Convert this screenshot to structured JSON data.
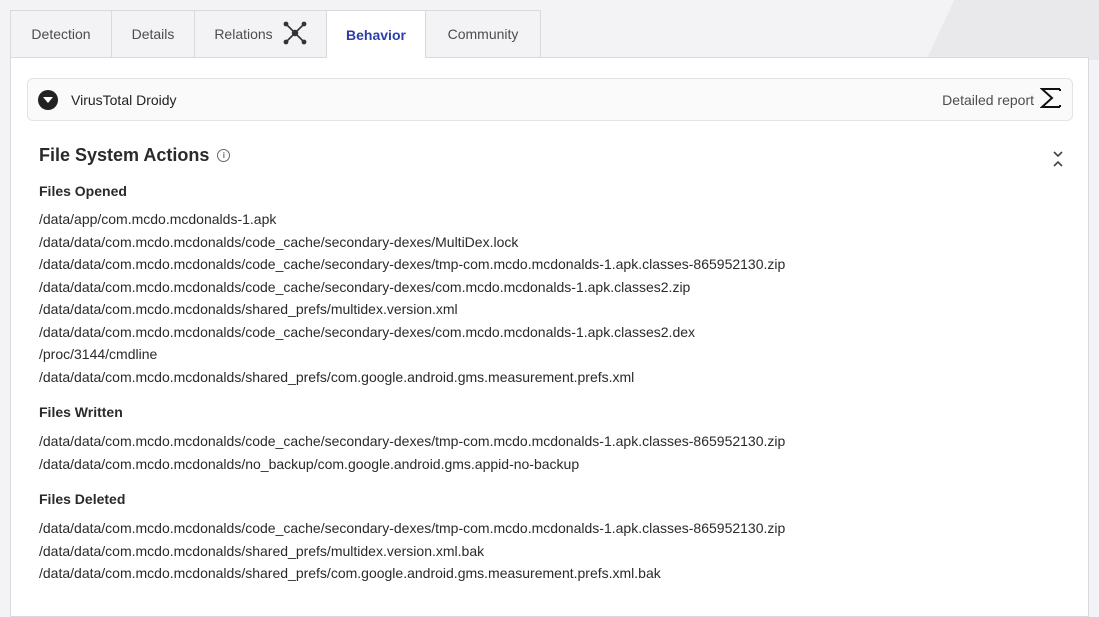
{
  "tabs": [
    {
      "label": "Detection"
    },
    {
      "label": "Details"
    },
    {
      "label": "Relations",
      "icon": "graph-nodes-icon"
    },
    {
      "label": "Behavior",
      "active": true
    },
    {
      "label": "Community"
    }
  ],
  "sandbox": {
    "name": "VirusTotal Droidy",
    "report_label": "Detailed report",
    "report_icon": "sigma-icon"
  },
  "section": {
    "title": "File System Actions",
    "info_icon": "info-icon",
    "collapse_icon": "collapse-icon"
  },
  "groups": {
    "opened": {
      "title": "Files Opened",
      "files": [
        "/data/app/com.mcdo.mcdonalds-1.apk",
        "/data/data/com.mcdo.mcdonalds/code_cache/secondary-dexes/MultiDex.lock",
        "/data/data/com.mcdo.mcdonalds/code_cache/secondary-dexes/tmp-com.mcdo.mcdonalds-1.apk.classes-865952130.zip",
        "/data/data/com.mcdo.mcdonalds/code_cache/secondary-dexes/com.mcdo.mcdonalds-1.apk.classes2.zip",
        "/data/data/com.mcdo.mcdonalds/shared_prefs/multidex.version.xml",
        "/data/data/com.mcdo.mcdonalds/code_cache/secondary-dexes/com.mcdo.mcdonalds-1.apk.classes2.dex",
        "/proc/3144/cmdline",
        "/data/data/com.mcdo.mcdonalds/shared_prefs/com.google.android.gms.measurement.prefs.xml"
      ]
    },
    "written": {
      "title": "Files Written",
      "files": [
        "/data/data/com.mcdo.mcdonalds/code_cache/secondary-dexes/tmp-com.mcdo.mcdonalds-1.apk.classes-865952130.zip",
        "/data/data/com.mcdo.mcdonalds/no_backup/com.google.android.gms.appid-no-backup"
      ]
    },
    "deleted": {
      "title": "Files Deleted",
      "files": [
        "/data/data/com.mcdo.mcdonalds/code_cache/secondary-dexes/tmp-com.mcdo.mcdonalds-1.apk.classes-865952130.zip",
        "/data/data/com.mcdo.mcdonalds/shared_prefs/multidex.version.xml.bak",
        "/data/data/com.mcdo.mcdonalds/shared_prefs/com.google.android.gms.measurement.prefs.xml.bak"
      ]
    }
  },
  "colors": {
    "active_tab_text": "#2e3ea8",
    "page_bg": "#f3f3f5",
    "panel_bg": "#ffffff"
  }
}
